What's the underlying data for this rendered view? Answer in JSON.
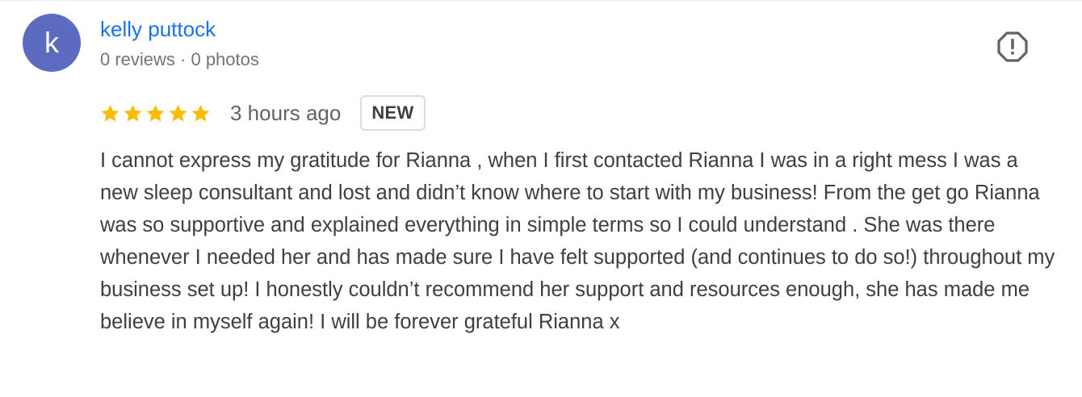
{
  "author": {
    "initial": "k",
    "name": "kelly puttock",
    "meta": "0 reviews · 0 photos",
    "avatar_color": "#5c6bc0"
  },
  "review": {
    "rating": 5,
    "max_rating": 5,
    "time": "3 hours ago",
    "badge": "NEW",
    "text": "I cannot express my gratitude for Rianna , when I first contacted Rianna I was in a right mess I was a new sleep consultant and lost and didn’t know where to start with my business! From the get go Rianna was so supportive and explained everything in simple terms so I could understand . She was there whenever I needed her and has made sure I have felt supported (and continues to do so!) throughout my business set up! I honestly couldn’t recommend her support and resources enough, she has made me believe in myself again! I will be forever grateful Rianna x"
  },
  "icons": {
    "report": "report-icon",
    "star": "star-icon"
  },
  "colors": {
    "link": "#1a73e8",
    "star": "#fbbc04",
    "meta": "#70757a"
  }
}
